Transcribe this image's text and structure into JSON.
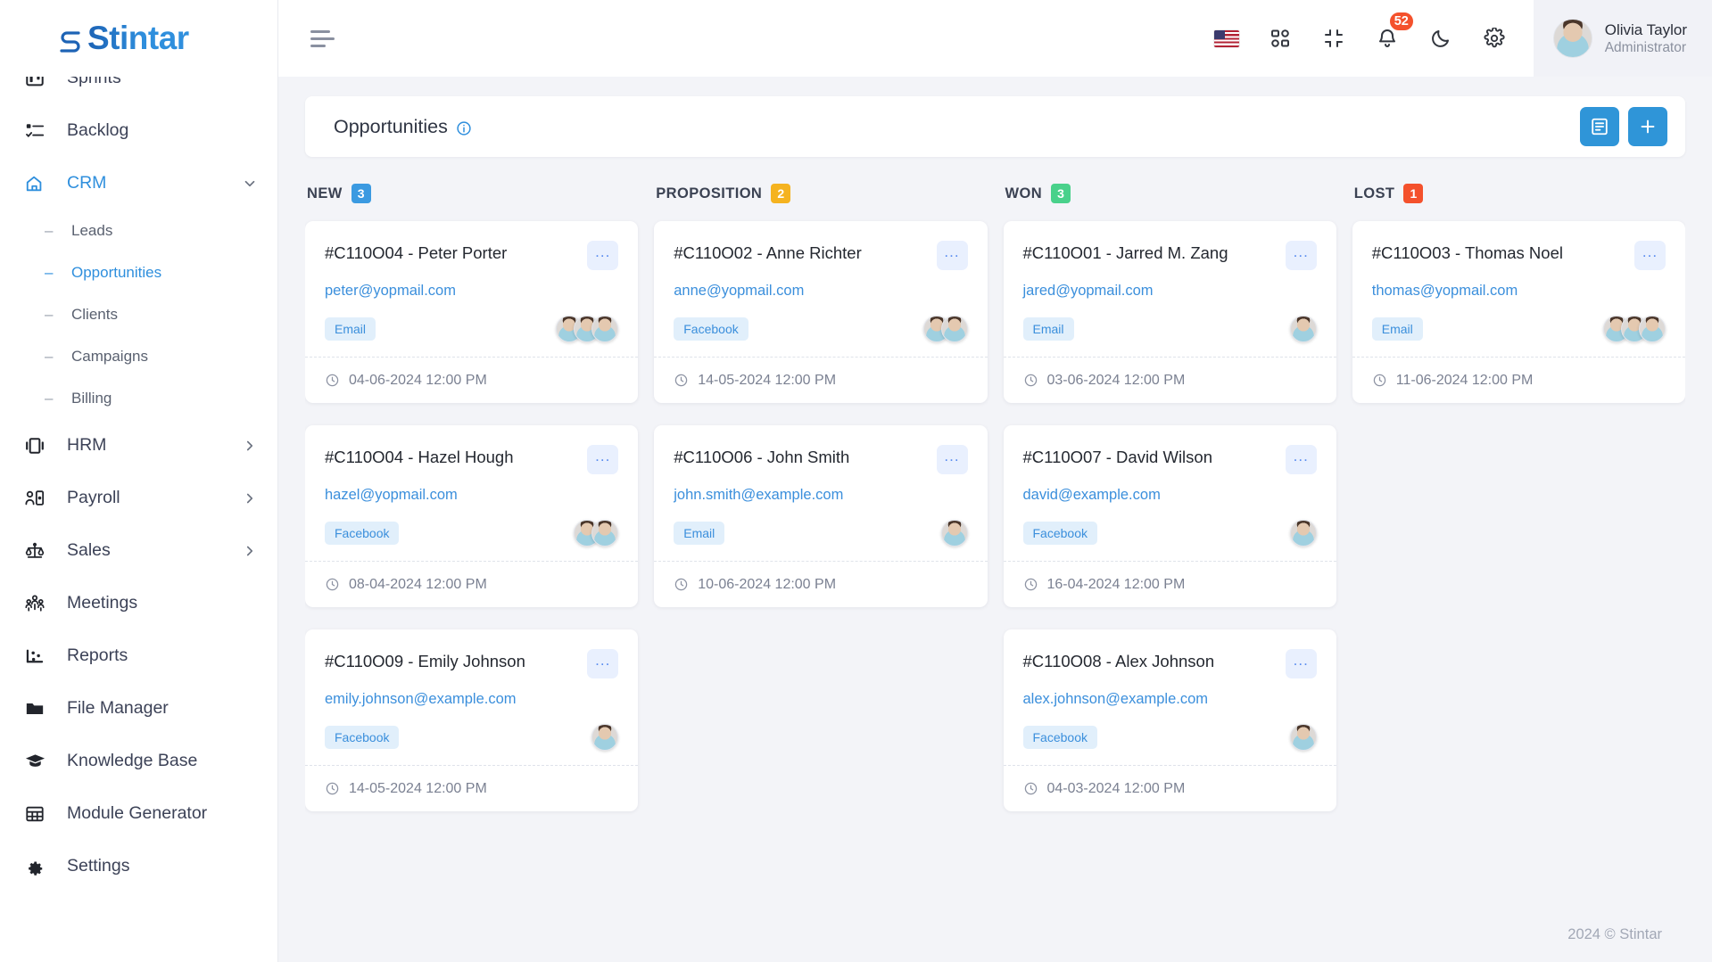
{
  "brand": {
    "name": "Stintar"
  },
  "sidebar": {
    "items": [
      {
        "label": "Sprints",
        "icon": "board-icon",
        "active": false,
        "expandable": false
      },
      {
        "label": "Backlog",
        "icon": "checklist-icon",
        "active": false,
        "expandable": false
      },
      {
        "label": "CRM",
        "icon": "crm-icon",
        "active": true,
        "expandable": true,
        "expanded": true
      },
      {
        "label": "HRM",
        "icon": "hrm-icon",
        "active": false,
        "expandable": true
      },
      {
        "label": "Payroll",
        "icon": "payroll-icon",
        "active": false,
        "expandable": true
      },
      {
        "label": "Sales",
        "icon": "scales-icon",
        "active": false,
        "expandable": true
      },
      {
        "label": "Meetings",
        "icon": "people-icon",
        "active": false,
        "expandable": false
      },
      {
        "label": "Reports",
        "icon": "chart-icon",
        "active": false,
        "expandable": false
      },
      {
        "label": "File Manager",
        "icon": "folder-icon",
        "active": false,
        "expandable": false
      },
      {
        "label": "Knowledge Base",
        "icon": "graduation-cap-icon",
        "active": false,
        "expandable": false
      },
      {
        "label": "Module Generator",
        "icon": "grid-table-icon",
        "active": false,
        "expandable": false
      },
      {
        "label": "Settings",
        "icon": "gear-icon",
        "active": false,
        "expandable": false
      }
    ],
    "crm_submenu": [
      {
        "label": "Leads",
        "active": false
      },
      {
        "label": "Opportunities",
        "active": true
      },
      {
        "label": "Clients",
        "active": false
      },
      {
        "label": "Campaigns",
        "active": false
      },
      {
        "label": "Billing",
        "active": false
      }
    ]
  },
  "topbar": {
    "menu_toggle": "hamburger-icon",
    "language_flag": "us-flag-icon",
    "apps_icon": "apps-grid-icon",
    "fullscreen_icon": "compress-icon",
    "notifications_icon": "bell-icon",
    "notifications_count": "52",
    "theme_icon": "moon-icon",
    "settings_icon": "gear-icon",
    "user": {
      "name": "Olivia Taylor",
      "role": "Administrator",
      "avatar": "user-avatar"
    }
  },
  "page": {
    "title": "Opportunities",
    "info_icon": "info-circle-icon",
    "list_view_label": "▤",
    "add_label": "+"
  },
  "columns": [
    {
      "title": "NEW",
      "count": "3",
      "color": "#3b9ae1",
      "cards": [
        {
          "title": "#C110O04 - Peter Porter",
          "email": "peter@yopmail.com",
          "tag": "Email",
          "avatars": 3,
          "date": "04-06-2024 12:00 PM",
          "menu": "..."
        },
        {
          "title": "#C110O04 - Hazel Hough",
          "email": "hazel@yopmail.com",
          "tag": "Facebook",
          "avatars": 2,
          "date": "08-04-2024 12:00 PM",
          "menu": "..."
        },
        {
          "title": "#C110O09 - Emily Johnson",
          "email": "emily.johnson@example.com",
          "tag": "Facebook",
          "avatars": 1,
          "date": "14-05-2024 12:00 PM",
          "menu": "..."
        }
      ]
    },
    {
      "title": "PROPOSITION",
      "count": "2",
      "color": "#f5b320",
      "cards": [
        {
          "title": "#C110O02 - Anne Richter",
          "email": "anne@yopmail.com",
          "tag": "Facebook",
          "avatars": 2,
          "date": "14-05-2024 12:00 PM",
          "menu": "..."
        },
        {
          "title": "#C110O06 - John Smith",
          "email": "john.smith@example.com",
          "tag": "Email",
          "avatars": 1,
          "date": "10-06-2024 12:00 PM",
          "menu": "..."
        }
      ]
    },
    {
      "title": "WON",
      "count": "3",
      "color": "#49d18b",
      "cards": [
        {
          "title": "#C110O01 - Jarred M. Zang",
          "email": "jared@yopmail.com",
          "tag": "Email",
          "avatars": 1,
          "date": "03-06-2024 12:00 PM",
          "menu": "..."
        },
        {
          "title": "#C110O07 - David Wilson",
          "email": "david@example.com",
          "tag": "Facebook",
          "avatars": 1,
          "date": "16-04-2024 12:00 PM",
          "menu": "..."
        },
        {
          "title": "#C110O08 - Alex Johnson",
          "email": "alex.johnson@example.com",
          "tag": "Facebook",
          "avatars": 1,
          "date": "04-03-2024 12:00 PM",
          "menu": "..."
        }
      ]
    },
    {
      "title": "LOST",
      "count": "1",
      "color": "#f4512c",
      "cards": [
        {
          "title": "#C110O03 - Thomas Noel",
          "email": "thomas@yopmail.com",
          "tag": "Email",
          "avatars": 3,
          "date": "11-06-2024 12:00 PM",
          "menu": "..."
        }
      ]
    }
  ],
  "footer": {
    "text": "2024 © Stintar"
  }
}
